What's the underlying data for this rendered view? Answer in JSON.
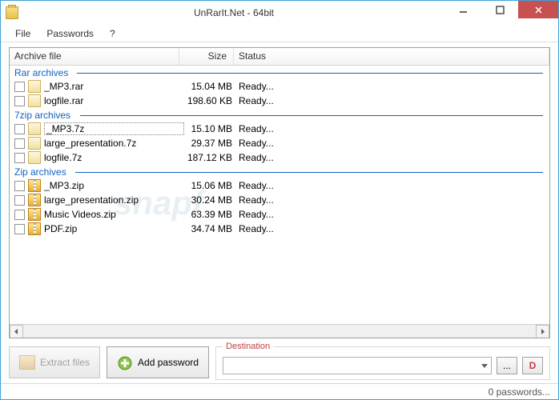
{
  "window": {
    "title": "UnRarIt.Net - 64bit"
  },
  "menu": {
    "file": "File",
    "passwords": "Passwords",
    "help": "?"
  },
  "columns": {
    "file": "Archive file",
    "size": "Size",
    "status": "Status"
  },
  "groups": [
    {
      "label": "Rar archives",
      "type": "rar",
      "tw": "78px",
      "items": [
        {
          "name": "_MP3.rar",
          "size": "15.04 MB",
          "status": "Ready..."
        },
        {
          "name": "logfile.rar",
          "size": "198.60 KB",
          "status": "Ready..."
        }
      ]
    },
    {
      "label": "7zip archives",
      "type": "sz",
      "tw": "82px",
      "items": [
        {
          "name": "_MP3.7z",
          "size": "15.10 MB",
          "status": "Ready...",
          "selected": true
        },
        {
          "name": "large_presentation.7z",
          "size": "29.37 MB",
          "status": "Ready..."
        },
        {
          "name": "logfile.7z",
          "size": "187.12 KB",
          "status": "Ready..."
        }
      ]
    },
    {
      "label": "Zip archives",
      "type": "zip",
      "tw": "76px",
      "items": [
        {
          "name": "_MP3.zip",
          "size": "15.06 MB",
          "status": "Ready..."
        },
        {
          "name": "large_presentation.zip",
          "size": "30.24 MB",
          "status": "Ready..."
        },
        {
          "name": "Music Videos.zip",
          "size": "63.39 MB",
          "status": "Ready..."
        },
        {
          "name": "PDF.zip",
          "size": "34.74 MB",
          "status": "Ready..."
        }
      ]
    }
  ],
  "buttons": {
    "extract": "Extract files",
    "addpw": "Add password"
  },
  "destination": {
    "label": "Destination",
    "browse": "...",
    "d": "D",
    "value": ""
  },
  "status": "0 passwords..."
}
